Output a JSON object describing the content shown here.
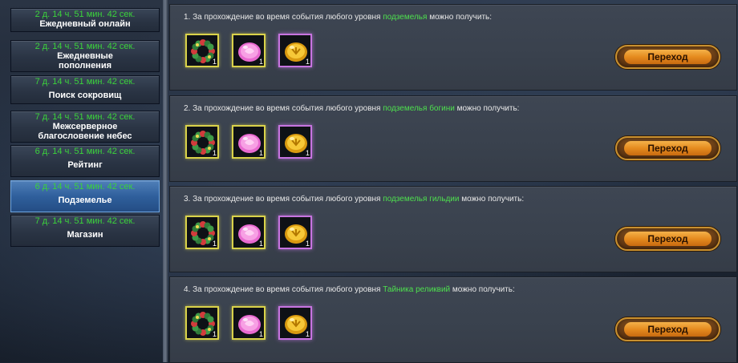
{
  "sidebar": {
    "items": [
      {
        "timer": "2 д. 14 ч. 51 мин. 42 сек.",
        "label": "Ежедневный онлайн",
        "active": false
      },
      {
        "timer": "2 д. 14 ч. 51 мин. 42 сек.",
        "label": "Ежедневные пополнения",
        "active": false
      },
      {
        "timer": "7 д. 14 ч. 51 мин. 42 сек.",
        "label": "Поиск сокровищ",
        "active": false
      },
      {
        "timer": "7 д. 14 ч. 51 мин. 42 сек.",
        "label": "Межсерверное благословение небес",
        "active": false
      },
      {
        "timer": "6 д. 14 ч. 51 мин. 42 сек.",
        "label": "Рейтинг",
        "active": false
      },
      {
        "timer": "6 д. 14 ч. 51 мин. 42 сек.",
        "label": "Подземелье",
        "active": true
      },
      {
        "timer": "7 д. 14 ч. 51 мин. 42 сек.",
        "label": "Магазин",
        "active": false
      }
    ]
  },
  "quests": [
    {
      "prefix": "1. За прохождение во время события любого уровня ",
      "highlight": "подземелья",
      "suffix": " можно получить:",
      "button": "Переход",
      "rewards": [
        {
          "icon": "wreath-icon",
          "qty": "1"
        },
        {
          "icon": "pink-gem-icon",
          "qty": "1"
        },
        {
          "icon": "gold-coin-icon",
          "qty": "1"
        }
      ]
    },
    {
      "prefix": "2. За прохождение во время события любого уровня ",
      "highlight": "подземелья богини",
      "suffix": " можно получить:",
      "button": "Переход",
      "rewards": [
        {
          "icon": "wreath-icon",
          "qty": "1"
        },
        {
          "icon": "pink-gem-icon",
          "qty": "1"
        },
        {
          "icon": "gold-coin-icon",
          "qty": "1"
        }
      ]
    },
    {
      "prefix": "3. За прохождение во время события любого уровня ",
      "highlight": "подземелья гильдии",
      "suffix": " можно получить:",
      "button": "Переход",
      "rewards": [
        {
          "icon": "wreath-icon",
          "qty": "1"
        },
        {
          "icon": "pink-gem-icon",
          "qty": "1"
        },
        {
          "icon": "gold-coin-icon",
          "qty": "1"
        }
      ]
    },
    {
      "prefix": "4. За прохождение во время события любого уровня ",
      "highlight": "Тайника реликвий",
      "suffix": " можно получить:",
      "button": "Переход",
      "rewards": [
        {
          "icon": "wreath-icon",
          "qty": "1"
        },
        {
          "icon": "pink-gem-icon",
          "qty": "1"
        },
        {
          "icon": "gold-coin-icon",
          "qty": "1"
        }
      ]
    }
  ],
  "colors": {
    "timer": "#3bd23b",
    "highlight": "#4ee04e",
    "active_tab": "#2f5f9c",
    "button": "#e58b1f"
  }
}
